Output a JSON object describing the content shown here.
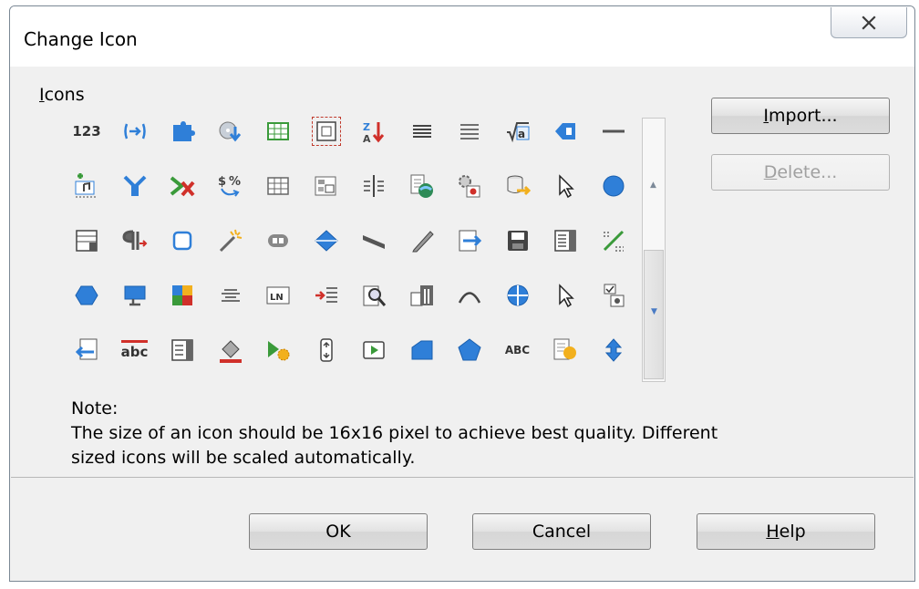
{
  "window": {
    "title": "Change Icon",
    "close_glyph": "✕"
  },
  "icons_group": {
    "label_prefix": "",
    "label_underlined": "I",
    "label_rest": "cons"
  },
  "buttons": {
    "import": {
      "u": "I",
      "pre": "",
      "post": "mport..."
    },
    "delete": {
      "pre": "",
      "u": "D",
      "post": "elete..."
    },
    "ok": "OK",
    "cancel": "Cancel",
    "help": {
      "pre": "",
      "u": "H",
      "post": "elp"
    }
  },
  "note": {
    "heading": "Note:",
    "line1": "The size of an icon should be 16x16 pixel to achieve best quality. Different",
    "line2": "sized icons will be scaled automatically."
  },
  "icon_grid": {
    "rows": [
      [
        "numbering-123-icon",
        "arrow-bracket-icon",
        "puzzle-icon",
        "cd-arrow-icon",
        "table-grid-icon",
        "insert-frame-icon",
        "sort-za-icon",
        "align-lines-icon",
        "align-justify-icon",
        "formula-icon",
        "tag-arrow-icon",
        "horizontal-line-icon"
      ],
      [
        "insert-music-icon",
        "filter-branch-icon",
        "delete-arrow-icon",
        "currency-percent-icon",
        "table-icon",
        "form-control-icon",
        "column-split-icon",
        "book-earth-icon",
        "gear-record-icon",
        "database-arrow-icon",
        "cursor-icon",
        "blue-circle-icon"
      ],
      [
        "form-list-icon",
        "paragraph-icon",
        "rounded-square-icon",
        "magic-wand-icon",
        "link-button-icon",
        "diamond-icon",
        "parallelogram-icon",
        "pencil-icon",
        "import-arrow-icon",
        "save-disk-icon",
        "list-box-icon",
        "dotted-diagonal-icon"
      ],
      [
        "hexagon-icon",
        "monitor-icon",
        "color-palette-icon",
        "center-align-icon",
        "line-numbers-icon",
        "indent-icon",
        "zoom-text-icon",
        "field-icon",
        "arc-icon",
        "crosshair-circle-icon",
        "pointer-icon",
        "checkbox-radio-icon"
      ],
      [
        "back-arrow-doc-icon",
        "spellcheck-abc-icon",
        "combo-box-icon",
        "paint-bucket-icon",
        "run-macro-icon",
        "spin-field-icon",
        "play-button-icon",
        "folder-shape-icon",
        "pentagon-icon",
        "abc-label-icon",
        "note-sun-icon",
        "vertical-arrows-icon"
      ]
    ],
    "text_icons": {
      "numbering-123-icon": "123",
      "abc-label-icon": "ABC",
      "spellcheck-abc-icon": "abc"
    }
  },
  "colors": {
    "accent_blue": "#2f7fd8",
    "selection_border": "#c0392b"
  }
}
